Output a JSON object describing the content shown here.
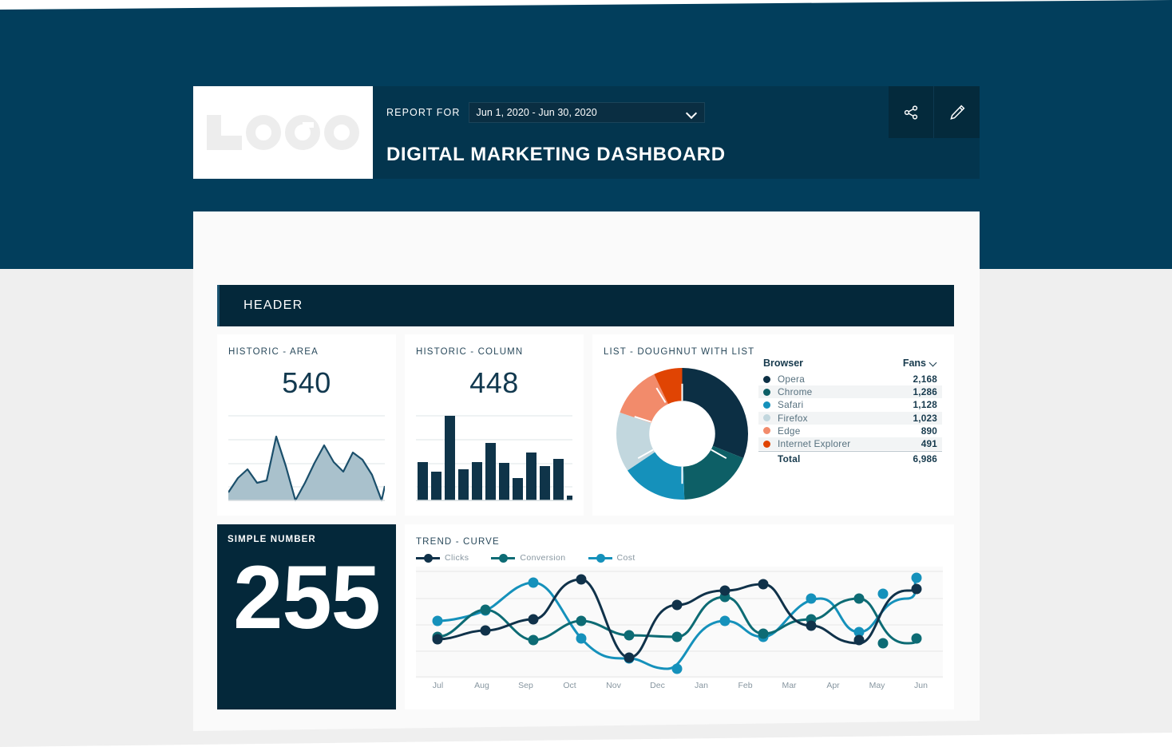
{
  "header": {
    "logo_text": "LOGO",
    "report_for_label": "REPORT FOR",
    "date_range": "Jun 1, 2020 - Jun 30, 2020",
    "title": "DIGITAL MARKETING DASHBOARD",
    "share_icon": "share-icon",
    "edit_icon": "pencil-icon"
  },
  "section": {
    "header_label": "HEADER"
  },
  "cards": {
    "area": {
      "title": "HISTORIC - AREA",
      "value": "540"
    },
    "column": {
      "title": "HISTORIC - COLUMN",
      "value": "448"
    },
    "list": {
      "title": "LIST - DOUGHNUT WITH LIST"
    },
    "simple_number": {
      "title": "SIMPLE NUMBER",
      "value": "255"
    },
    "trend": {
      "title": "TREND - CURVE"
    }
  },
  "browser_table": {
    "col_browser": "Browser",
    "col_fans": "Fans",
    "sort_icon": "chevron-down-icon",
    "rows": [
      {
        "name": "Opera",
        "fans": "2,168",
        "color": "#0c2f44"
      },
      {
        "name": "Chrome",
        "fans": "1,286",
        "color": "#0d5f66"
      },
      {
        "name": "Safari",
        "fans": "1,128",
        "color": "#1591bb"
      },
      {
        "name": "Firefox",
        "fans": "1,023",
        "color": "#c2d7de"
      },
      {
        "name": "Edge",
        "fans": "890",
        "color": "#f28b6b"
      },
      {
        "name": "Internet Explorer",
        "fans": "491",
        "color": "#e04403"
      }
    ],
    "total_label": "Total",
    "total_value": "6,986"
  },
  "colors": {
    "navy_bg": "#023e5c",
    "gray_bg": "#efefef",
    "panel_dark": "#04283a",
    "topbar": "#03354e",
    "accent_teal": "#1591bb",
    "area_fill": "#a9c1cc",
    "area_line": "#1b4f6b",
    "bar_fill": "#0f3449"
  },
  "chart_data": [
    {
      "type": "area",
      "title": "HISTORIC - AREA",
      "value": 540,
      "x": [
        0,
        1,
        2,
        3,
        4,
        5,
        6,
        7,
        8,
        9,
        10,
        11,
        12,
        13,
        14,
        15,
        16
      ],
      "values": [
        12,
        34,
        45,
        22,
        26,
        96,
        48,
        2,
        26,
        52,
        74,
        54,
        42,
        66,
        58,
        40,
        4
      ],
      "ylim": [
        0,
        100
      ],
      "grid": true,
      "xlabel": "",
      "ylabel": ""
    },
    {
      "type": "bar",
      "title": "HISTORIC - COLUMN",
      "value": 448,
      "categories": [
        "1",
        "2",
        "3",
        "4",
        "5",
        "6",
        "7",
        "8",
        "9",
        "10",
        "11",
        "12"
      ],
      "values": [
        46,
        33,
        100,
        36,
        46,
        72,
        45,
        26,
        62,
        41,
        51,
        6
      ],
      "ylim": [
        0,
        100
      ],
      "grid": true
    },
    {
      "type": "pie",
      "title": "LIST - DOUGHNUT WITH LIST",
      "labels": [
        "Opera",
        "Chrome",
        "Safari",
        "Firefox",
        "Edge",
        "Internet Explorer"
      ],
      "values": [
        2168,
        1286,
        1128,
        1023,
        890,
        491
      ],
      "colors": [
        "#0c2f44",
        "#0d5f66",
        "#1591bb",
        "#c2d7de",
        "#f28b6b",
        "#e04403"
      ],
      "total": 6986,
      "donut": true
    },
    {
      "type": "line",
      "title": "TREND - CURVE",
      "categories": [
        "Jul",
        "Aug",
        "Sep",
        "Oct",
        "Nov",
        "Dec",
        "Jan",
        "Feb",
        "Mar",
        "Apr",
        "May",
        "Jun"
      ],
      "legend_position": "top-left",
      "ylim": [
        0,
        100
      ],
      "grid": true,
      "series": [
        {
          "name": "Clicks",
          "color": "#10324a",
          "values": [
            33,
            44,
            56,
            88,
            24,
            70,
            53,
            76,
            80,
            48,
            36,
            74
          ]
        },
        {
          "name": "Conversion",
          "color": "#0d6b74",
          "values": [
            34,
            62,
            36,
            58,
            48,
            46,
            80,
            44,
            48,
            72,
            35,
            40
          ]
        },
        {
          "name": "Cost",
          "color": "#1591bb",
          "values": [
            52,
            62,
            86,
            40,
            24,
            12,
            56,
            44,
            76,
            52,
            76,
            92
          ]
        }
      ]
    }
  ]
}
